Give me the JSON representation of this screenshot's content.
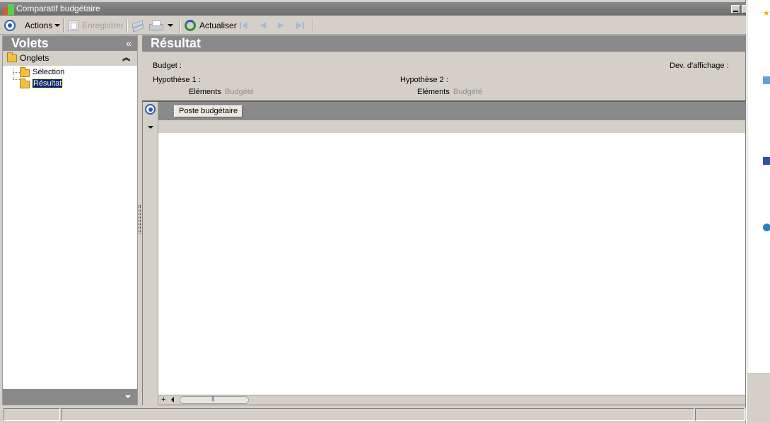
{
  "window": {
    "title": "Comparatif budgétaire"
  },
  "toolbar": {
    "actions_label": "Actions",
    "save_label": "Enregistrer",
    "refresh_label": "Actualiser"
  },
  "left_panel": {
    "title": "Volets",
    "collapse_glyph": "«",
    "group_label": "Onglets",
    "group_toggle_glyph": "⌃",
    "tree_items": [
      {
        "label": "Sélection",
        "selected": false
      },
      {
        "label": "Résultat",
        "selected": true
      }
    ]
  },
  "main": {
    "title": "Résultat",
    "budget_label": "Budget :",
    "display_currency_label": "Dev. d'affichage :",
    "hypothesis1_label": "Hypothèse 1 :",
    "hypothesis2_label": "Hypothèse 2 :",
    "elements1_label": "Eléments",
    "elements1_value": "Budgété",
    "elements2_label": "Eléments",
    "elements2_value": "Budgété",
    "grid": {
      "column_button_label": "Poste budgétaire",
      "plus_glyph": "+"
    }
  },
  "colors": {
    "panel_header": "#8a8a8a",
    "window_bg": "#d4d0c8",
    "selection_bg": "#0a246a",
    "accent_icon": "#2a5db0"
  },
  "icons": [
    "app-icon",
    "actions-icon",
    "save-icon",
    "sync-icon",
    "print-icon",
    "refresh-icon",
    "first-icon",
    "prev-icon",
    "next-icon",
    "last-icon",
    "folder-icon"
  ]
}
